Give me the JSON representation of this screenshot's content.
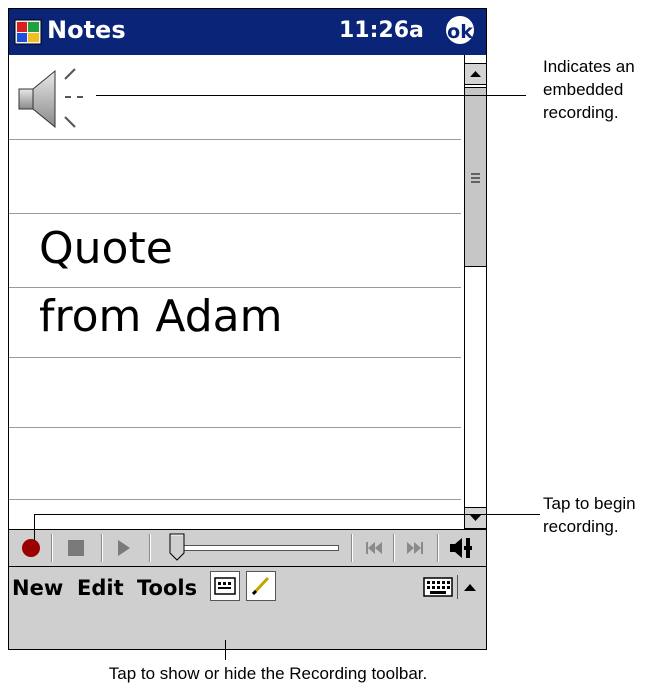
{
  "titlebar": {
    "title": "Notes",
    "time": "11:26a",
    "ok_label": "ok"
  },
  "note": {
    "lines": [
      "Quote",
      "from Adam"
    ]
  },
  "menubar": {
    "items": [
      "New",
      "Edit",
      "Tools"
    ]
  },
  "callouts": {
    "embedded": [
      "Indicates an",
      "embedded",
      "recording."
    ],
    "begin": [
      "Tap to begin",
      "recording."
    ],
    "toolbar": "Tap to show or hide the Recording toolbar."
  },
  "colors": {
    "titlebar": "#0a2478",
    "toolbar": "#cfcfcf",
    "record": "#9a0000"
  },
  "icons": [
    "notes-app-icon",
    "ok-icon",
    "speaker-recording-icon",
    "record-icon",
    "stop-icon",
    "play-icon",
    "slider-thumb-icon",
    "skip-back-icon",
    "skip-forward-icon",
    "volume-icon",
    "recording-toolbar-icon",
    "pen-icon",
    "keyboard-icon",
    "input-panel-arrow-icon"
  ]
}
